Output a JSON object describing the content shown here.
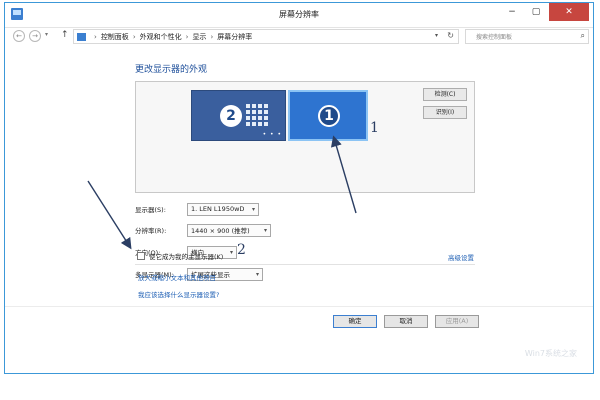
{
  "window": {
    "title": "屏幕分辨率",
    "controls": {
      "minimize": "−",
      "maximize": "▢",
      "close": "✕"
    }
  },
  "addressbar": {
    "back": "←",
    "forward": "→",
    "history": "▾",
    "up": "↑",
    "separator": "›",
    "breadcrumbs": [
      "控制面板",
      "外观和个性化",
      "显示",
      "屏幕分辨率"
    ],
    "dropdown": "▾",
    "refresh": "↻",
    "search": {
      "placeholder": "搜索控制面板",
      "value": ""
    },
    "search_icon": "⌕"
  },
  "main": {
    "heading": "更改显示器的外观",
    "monitors": [
      {
        "number": "2",
        "selected": false
      },
      {
        "number": "1",
        "selected": true
      }
    ],
    "monitor_dots": "• • •",
    "detect_label": "检测(C)",
    "identify_label": "识别(I)",
    "settings": [
      {
        "label": "显示器(S):",
        "value": "1. LEN L1950wD"
      },
      {
        "label": "分辨率(R):",
        "value": "1440 × 900 (推荐)"
      },
      {
        "label": "方向(O):",
        "value": "横向"
      },
      {
        "label": "多显示器(M):",
        "value": "扩展这些显示"
      }
    ],
    "caret": "▾",
    "primary_checkbox": {
      "label": "使它成为我的主显示器(K)",
      "checked": false
    },
    "advanced_link": "高级设置",
    "link_text_size": "放大或缩小文本和其他项目",
    "link_which_settings": "我应该选择什么显示器设置?"
  },
  "footer": {
    "ok": "确定",
    "cancel": "取消",
    "apply": "应用(A)"
  },
  "annotations": {
    "label_1": "1",
    "label_2": "2",
    "arrow_color": "#2b3e63"
  },
  "watermark": "Win7系统之家",
  "colors": {
    "border": "#3c98d8",
    "close": "#c7463f",
    "link": "#1e5fb4",
    "monitor_selected": "#2e74d0",
    "monitor_other": "#3a5f9e"
  }
}
